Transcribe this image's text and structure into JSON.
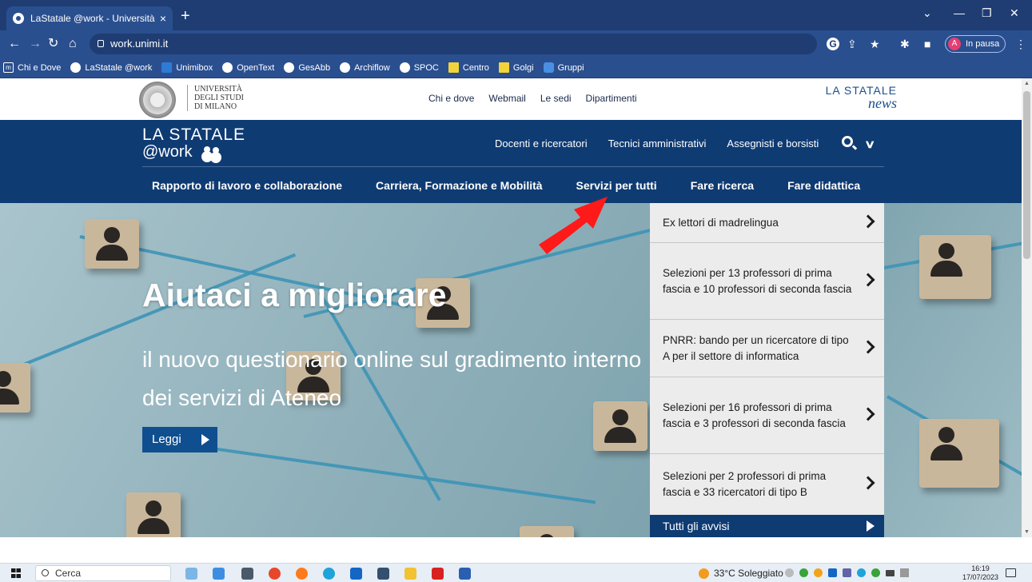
{
  "browser": {
    "tab_title": "LaStatale @work - Università deg",
    "new_tab": "+",
    "url": "work.unimi.it",
    "profile_initial": "A",
    "profile_status": "In pausa",
    "bookmarks": [
      "Chi e Dove",
      "LaStatale @work",
      "Unimibox",
      "OpenText",
      "GesAbb",
      "Archiflow",
      "SPOC",
      "Centro",
      "Golgi",
      "Gruppi"
    ]
  },
  "site": {
    "university_lines": [
      "UNIVERSITÀ",
      "DEGLI STUDI",
      "DI MILANO"
    ],
    "top_links": [
      "Chi e dove",
      "Webmail",
      "Le sedi",
      "Dipartimenti"
    ],
    "news_brand": [
      "LA STATALE",
      "news"
    ],
    "work_brand": [
      "LA STATALE",
      "@work"
    ],
    "roles": [
      "Docenti e ricercatori",
      "Tecnici amministrativi",
      "Assegnisti e borsisti"
    ],
    "main_nav": [
      "Rapporto di lavoro e collaborazione",
      "Carriera, Formazione e Mobilità",
      "Servizi per tutti",
      "Fare ricerca",
      "Fare didattica"
    ]
  },
  "hero": {
    "title": "Aiutaci a migliorare",
    "subtitle": "il nuovo questionario online sul gradimento interno dei servizi di Ateneo",
    "button": "Leggi"
  },
  "notices": {
    "items": [
      "Ex lettori di madrelingua",
      "Selezioni per 13 professori di prima fascia e 10 professori di seconda fascia",
      "PNRR: bando per un ricercatore di tipo A per il settore di informatica",
      "Selezioni per 16 professori di prima fascia e 3 professori di seconda fascia",
      "Selezioni per 2 professori di prima fascia e 33 ricercatori di tipo B"
    ],
    "all_label": "Tutti gli avvisi"
  },
  "taskbar": {
    "search_placeholder": "Cerca",
    "weather": "33°C Soleggiato",
    "time": "16:19",
    "date": "17/07/2023"
  },
  "colors": {
    "chrome_dark": "#1f3d73",
    "chrome": "#2a4f8f",
    "site_blue": "#0f3b73",
    "annotation_arrow": "#ff1a1a"
  }
}
